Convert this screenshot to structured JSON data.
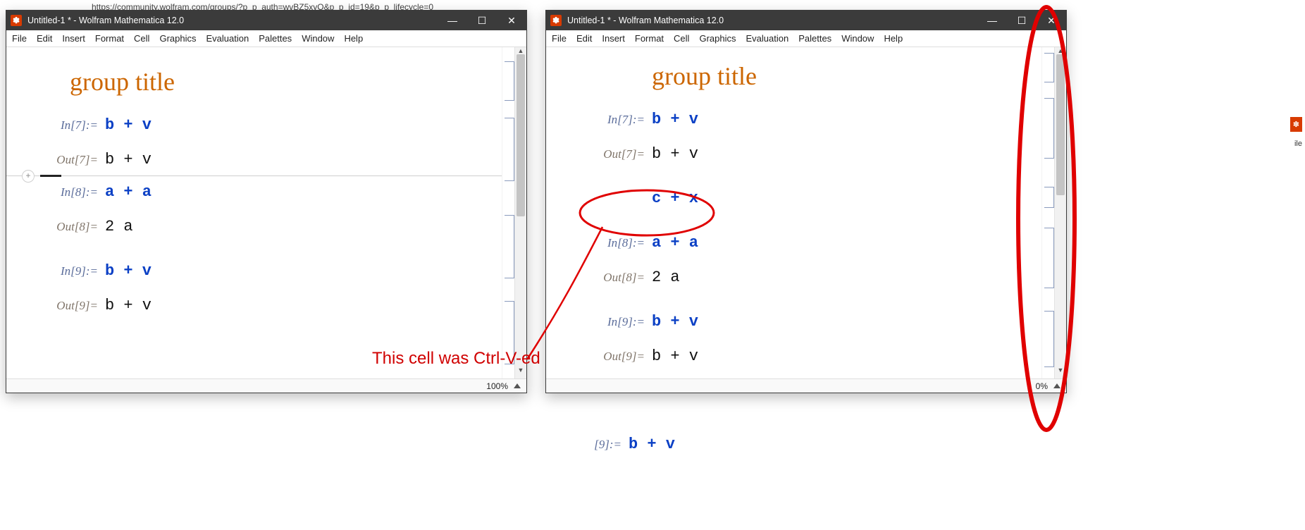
{
  "browser_url": "https://community.wolfram.com/groups/?p_p_auth=wvBZ5xyO&p_p_id=19&p_p_lifecycle=0",
  "app_title": "Untitled-1 * - Wolfram Mathematica 12.0",
  "menu": [
    "File",
    "Edit",
    "Insert",
    "Format",
    "Cell",
    "Graphics",
    "Evaluation",
    "Palettes",
    "Window",
    "Help"
  ],
  "section_title": "group title",
  "zoom": "100%",
  "left": {
    "cells": [
      {
        "in_label": "In[7]:=",
        "in_expr": "b + v",
        "out_label": "Out[7]=",
        "out_expr": "b + v"
      },
      {
        "in_label": "In[8]:=",
        "in_expr": "a + a",
        "out_label": "Out[8]=",
        "out_expr": "2 a"
      },
      {
        "in_label": "In[9]:=",
        "in_expr": "b + v",
        "out_label": "Out[9]=",
        "out_expr": "b + v"
      }
    ]
  },
  "right": {
    "cells": [
      {
        "in_label": "In[7]:=",
        "in_expr": "b + v",
        "out_label": "Out[7]=",
        "out_expr": "b + v"
      },
      {
        "orphan_expr": "c + x"
      },
      {
        "in_label": "In[8]:=",
        "in_expr": "a + a",
        "out_label": "Out[8]=",
        "out_expr": "2 a"
      },
      {
        "in_label": "In[9]:=",
        "in_expr": "b + v",
        "out_label": "Out[9]=",
        "out_expr": "b + v"
      }
    ]
  },
  "stray_below": {
    "label": "[9]:=",
    "expr": "b + v"
  },
  "annotation_text": "This cell was Ctrl-V-ed",
  "right_zoom_partial": "0%",
  "frag_file": "ile"
}
